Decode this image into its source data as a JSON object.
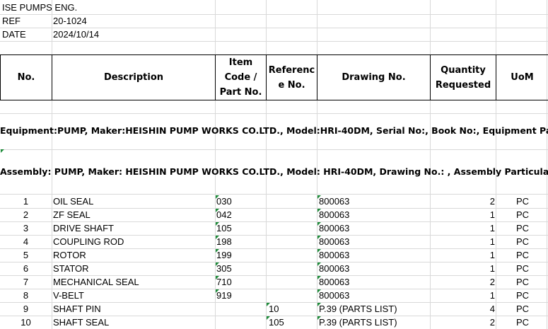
{
  "meta": {
    "company": "ISE PUMPS ENG.",
    "ref_label": "REF",
    "ref_value": "20-1024",
    "date_label": "DATE",
    "date_value": "2024/10/14"
  },
  "table_header": {
    "no": "No.",
    "description": "Description",
    "item_code_l1": "Item",
    "item_code_l2": "Code /",
    "item_code_l3": "Part No.",
    "reference_l1": "Referenc",
    "reference_l2": "e No.",
    "drawing_no": "Drawing No.",
    "quantity_l1": "Quantity",
    "quantity_l2": "Requested",
    "uom": "UoM"
  },
  "equipment_line": "Equipment:PUMP, Maker:HEISHIN PUMP WORKS CO.LTD., Model:HRI-40DM, Serial No:, Book No:, Equipment Particulars:",
  "assembly_line": "Assembly: PUMP, Maker: HEISHIN PUMP WORKS CO.LTD., Model: HRI-40DM, Drawing No.: , Assembly Particulars:",
  "rows": [
    {
      "no": "1",
      "desc": "OIL SEAL",
      "item": "030",
      "ref": "",
      "drawing": "800063",
      "qty": "2",
      "uom": "PC"
    },
    {
      "no": "2",
      "desc": "ZF SEAL",
      "item": "042",
      "ref": "",
      "drawing": "800063",
      "qty": "1",
      "uom": "PC"
    },
    {
      "no": "3",
      "desc": "DRIVE SHAFT",
      "item": "105",
      "ref": "",
      "drawing": "800063",
      "qty": "1",
      "uom": "PC"
    },
    {
      "no": "4",
      "desc": "COUPLING ROD",
      "item": "198",
      "ref": "",
      "drawing": "800063",
      "qty": "1",
      "uom": "PC"
    },
    {
      "no": "5",
      "desc": "ROTOR",
      "item": "199",
      "ref": "",
      "drawing": "800063",
      "qty": "1",
      "uom": "PC"
    },
    {
      "no": "6",
      "desc": "STATOR",
      "item": "305",
      "ref": "",
      "drawing": "800063",
      "qty": "1",
      "uom": "PC"
    },
    {
      "no": "7",
      "desc": "MECHANICAL SEAL",
      "item": "710",
      "ref": "",
      "drawing": "800063",
      "qty": "2",
      "uom": "PC"
    },
    {
      "no": "8",
      "desc": "V-BELT",
      "item": "919",
      "ref": "",
      "drawing": "800063",
      "qty": "1",
      "uom": "PC"
    },
    {
      "no": "9",
      "desc": "SHAFT PIN",
      "item": "",
      "ref": "10",
      "drawing": "P.39 (PARTS LIST)",
      "qty": "4",
      "uom": "PC"
    },
    {
      "no": "10",
      "desc": "SHAFT SEAL",
      "item": "",
      "ref": "105",
      "drawing": "P.39 (PARTS LIST)",
      "qty": "2",
      "uom": "PC"
    }
  ],
  "colors": {
    "gridline": "#d9d9d9",
    "border": "#000000",
    "text_indicator": "#1e8b3a"
  }
}
